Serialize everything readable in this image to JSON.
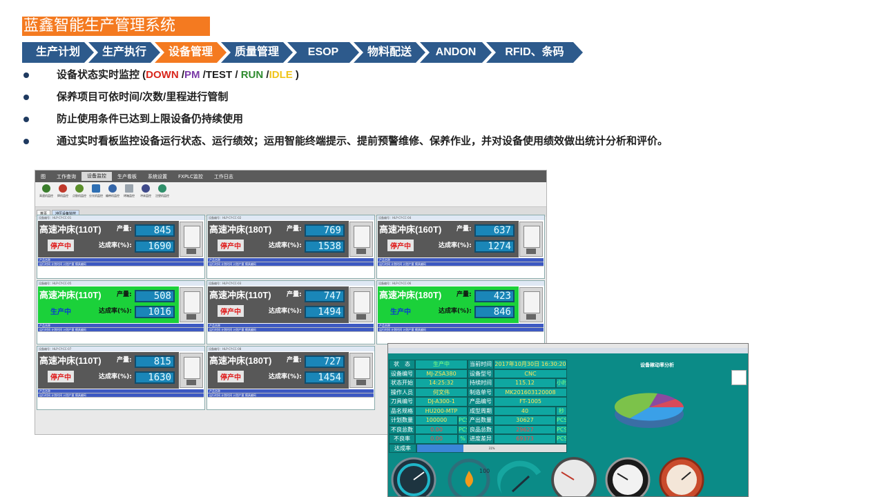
{
  "title": "蓝鑫智能生产管理系统",
  "ribbon": [
    "生产计划",
    "生产执行",
    "设备管理",
    "质量管理",
    "ESOP",
    "物料配送",
    "ANDON",
    "RFID、条码"
  ],
  "bullets": {
    "b1_prefix": "设备状态实时监控 (",
    "b1_down": "DOWN",
    "b1_sep1": " /",
    "b1_pm": "PM",
    "b1_sep2": " /",
    "b1_test": "TEST",
    "b1_sep3": " / ",
    "b1_run": "RUN",
    "b1_sep4": " /",
    "b1_idle": "IDLE",
    "b1_suffix": " )",
    "b2": "保养项目可依时间/次数/里程进行管制",
    "b3": "防止使用条件已达到上限设备仍持续使用",
    "b4": "通过实时看板监控设备运行状态、运行绩效；运用智能终端提示、提前预警维修、保养作业，并对设备使用绩效做出统计分析和评价。"
  },
  "colors": {
    "accent": "#f47a20",
    "ribbon": "#2d5a8c",
    "down": "#d9261c",
    "pm": "#7a3aa8",
    "run": "#2e8b2e",
    "idle": "#f0c419"
  },
  "shot1": {
    "menu": [
      "图",
      "工作查询",
      "设备监控",
      "生产看板",
      "系统设置",
      "FXPLC监控",
      "工作日志"
    ],
    "tools": [
      "高速机监控",
      "焊机监控",
      "点胶机监控",
      "分光机监控",
      "编带机监控",
      "烤箱监控",
      "冲床监控",
      "注塑机监控"
    ],
    "tabs": [
      "首页",
      "冲压设备监控"
    ],
    "label_qty": "产量:",
    "label_rate": "达成率(%):",
    "table_head": "产品名称",
    "table_cols": "运行时间   计划时间   计划产量   模具编码",
    "panels": [
      {
        "code": "设备编号：HLP-CY-CC-01",
        "name": "高速冲床(110T)",
        "status": "停产中",
        "qty": "845",
        "rate": "1690",
        "state": "stop"
      },
      {
        "code": "设备编号：HLP-CY-CC-02",
        "name": "高速冲床(180T)",
        "status": "停产中",
        "qty": "769",
        "rate": "1538",
        "state": "stop"
      },
      {
        "code": "设备编号：HLP-CY-CC-04",
        "name": "高速冲床(160T)",
        "status": "停产中",
        "qty": "637",
        "rate": "1274",
        "state": "stop"
      },
      {
        "code": "设备编号：HLP-CY-CC-05",
        "name": "高速冲床(110T)",
        "status": "生产中",
        "qty": "508",
        "rate": "1016",
        "state": "run"
      },
      {
        "code": "设备编号：HLP-CY-CC-03",
        "name": "高速冲床(110T)",
        "status": "停产中",
        "qty": "747",
        "rate": "1494",
        "state": "stop"
      },
      {
        "code": "设备编号：HLP-CY-CC-06",
        "name": "高速冲床(180T)",
        "status": "生产中",
        "qty": "423",
        "rate": "846",
        "state": "run"
      },
      {
        "code": "设备编号：HLP-CY-CC-07",
        "name": "高速冲床(110T)",
        "status": "停产中",
        "qty": "815",
        "rate": "1630",
        "state": "stop"
      },
      {
        "code": "设备编号：HLP-CY-CC-08",
        "name": "高速冲床(180T)",
        "status": "停产中",
        "qty": "727",
        "rate": "1454",
        "state": "stop"
      }
    ]
  },
  "shot2": {
    "rows": [
      [
        "状　态",
        "生产中",
        "当前时间",
        "2017年10月30日 16:30:20"
      ],
      [
        "设备编号",
        "MJ-ZSA380",
        "设备型号",
        "CNC"
      ],
      [
        "状态开始",
        "14:25:32",
        "持续时间",
        "115.12",
        "小时"
      ],
      [
        "操作人员",
        "何文伟",
        "制造单号",
        "MK201603120008"
      ],
      [
        "刀具编号",
        "DJ-A300-1",
        "产品编号",
        "FT-1005"
      ],
      [
        "品名规格",
        "HU200-MTP",
        "成型周期",
        "40",
        "秒"
      ],
      [
        "计划数量",
        "100000",
        "PCS",
        "产出数量",
        "30627",
        "PCS"
      ],
      [
        "不良总数",
        "0.00",
        "PCS",
        "良品总数",
        "29627",
        "PCS"
      ],
      [
        "不良率",
        "0.00",
        "%",
        "进度差异",
        "69373",
        "PCS"
      ]
    ],
    "rate_label": "达成率",
    "rate_value": 0.31,
    "rate_text": "31%",
    "pie_title": "设备稼动率分析",
    "gauge_text": "100"
  }
}
